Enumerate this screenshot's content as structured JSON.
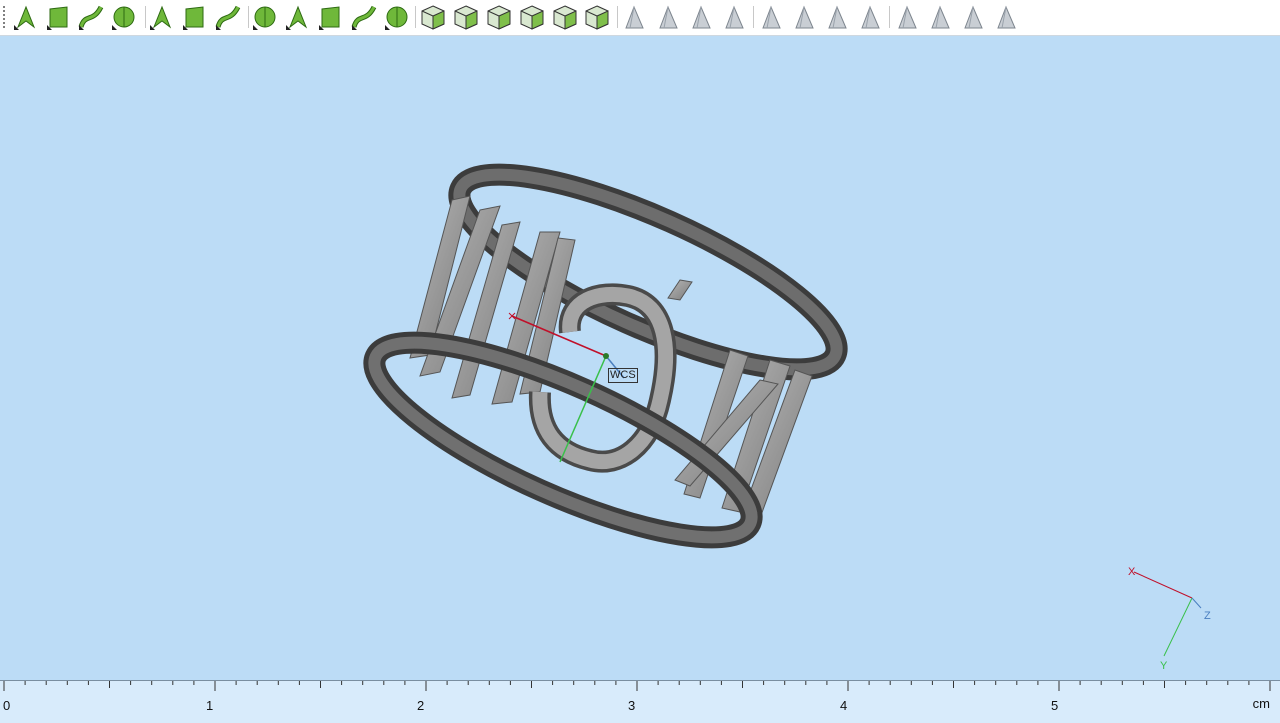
{
  "toolbar": {
    "tools": [
      {
        "name": "select-point-icon",
        "kind": "green"
      },
      {
        "name": "select-face-icon",
        "kind": "green"
      },
      {
        "name": "select-curve-icon",
        "kind": "green"
      },
      {
        "name": "select-sphere-icon",
        "kind": "green"
      },
      {
        "name": "select-rect-icon",
        "kind": "green"
      },
      {
        "name": "select-blob-icon",
        "kind": "green"
      },
      {
        "name": "select-path-icon",
        "kind": "green"
      },
      {
        "name": "select-patch-icon",
        "kind": "green"
      },
      {
        "name": "select-group-icon",
        "kind": "green"
      },
      {
        "name": "select-cluster-icon",
        "kind": "green"
      },
      {
        "name": "select-wheel-icon",
        "kind": "green"
      },
      {
        "name": "select-fan-icon",
        "kind": "green"
      },
      {
        "name": "cube-select-icon",
        "kind": "cube"
      },
      {
        "name": "cube-face-icon",
        "kind": "cube"
      },
      {
        "name": "cube-color-icon",
        "kind": "cube"
      },
      {
        "name": "cube-wire-icon",
        "kind": "cube"
      },
      {
        "name": "cube-solid-icon",
        "kind": "cube"
      },
      {
        "name": "cube-green-icon",
        "kind": "cube"
      },
      {
        "name": "mesh-select-icon",
        "kind": "gray"
      },
      {
        "name": "mesh-edge-icon",
        "kind": "gray"
      },
      {
        "name": "mesh-fold-icon",
        "kind": "gray"
      },
      {
        "name": "mesh-paint-icon",
        "kind": "gray"
      },
      {
        "name": "mesh-delete-icon",
        "kind": "gray"
      },
      {
        "name": "mesh-split-icon",
        "kind": "gray"
      },
      {
        "name": "mesh-copy-icon",
        "kind": "gray"
      },
      {
        "name": "mesh-flat-icon",
        "kind": "gray"
      },
      {
        "name": "mesh-view-icon",
        "kind": "gray"
      },
      {
        "name": "mesh-layers-icon",
        "kind": "gray"
      },
      {
        "name": "mesh-eye-icon",
        "kind": "gray"
      },
      {
        "name": "mesh-grid-icon",
        "kind": "gray"
      }
    ]
  },
  "viewport": {
    "wcs_label": "WCS",
    "triad": {
      "x": "X",
      "y": "Y",
      "z": "Z"
    }
  },
  "ruler": {
    "labels": [
      "0",
      "1",
      "2",
      "3",
      "4",
      "5"
    ],
    "unit": "cm"
  },
  "colors": {
    "background": "#bcdcf6",
    "axis_x": "#c0102a",
    "axis_y": "#39c04a",
    "axis_z": "#4a7fc0"
  }
}
